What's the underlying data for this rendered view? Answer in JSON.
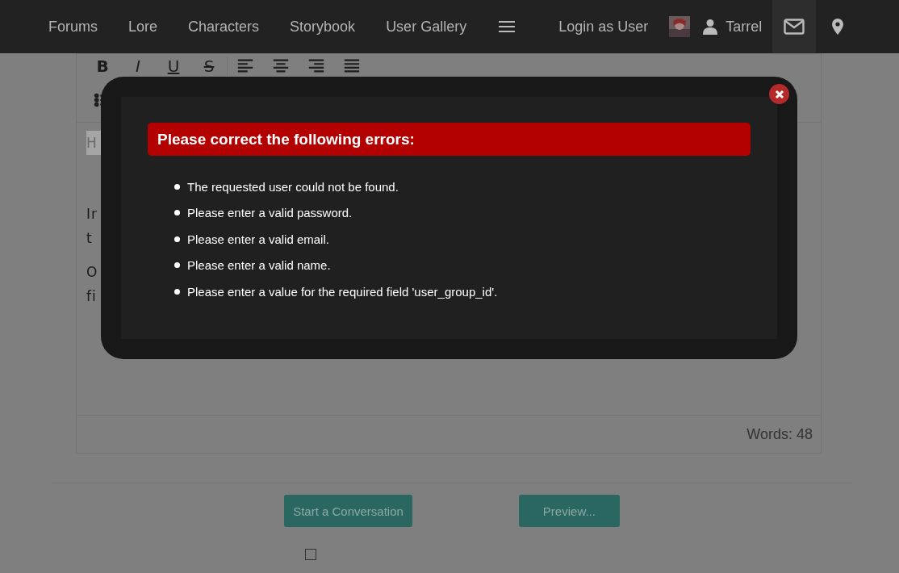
{
  "nav": {
    "items": [
      {
        "label": "Forums"
      },
      {
        "label": "Lore"
      },
      {
        "label": "Characters"
      },
      {
        "label": "Storybook"
      },
      {
        "label": "User Gallery"
      }
    ],
    "login": "Login as User",
    "user": "Tarrel"
  },
  "editor": {
    "format_buttons": [
      "B",
      "I",
      "U",
      "S"
    ],
    "paragraphs": [
      {
        "lines": [
          "H"
        ],
        "highlighted": true
      },
      {
        "lines": [
          "Ir",
          "t"
        ],
        "highlighted": false
      },
      {
        "lines": [
          "O",
          "fi"
        ],
        "highlighted": false
      }
    ],
    "word_count": "Words: 48"
  },
  "buttons": [
    "Start a Conversation",
    "Preview..."
  ],
  "checkbox": {
    "checked": false
  },
  "modal": {
    "title": "Please correct the following errors:",
    "errors": [
      "The requested user could not be found.",
      "Please enter a valid password.",
      "Please enter a valid email.",
      "Please enter a valid name.",
      "Please enter a value for the required field 'user_group_id'."
    ]
  }
}
